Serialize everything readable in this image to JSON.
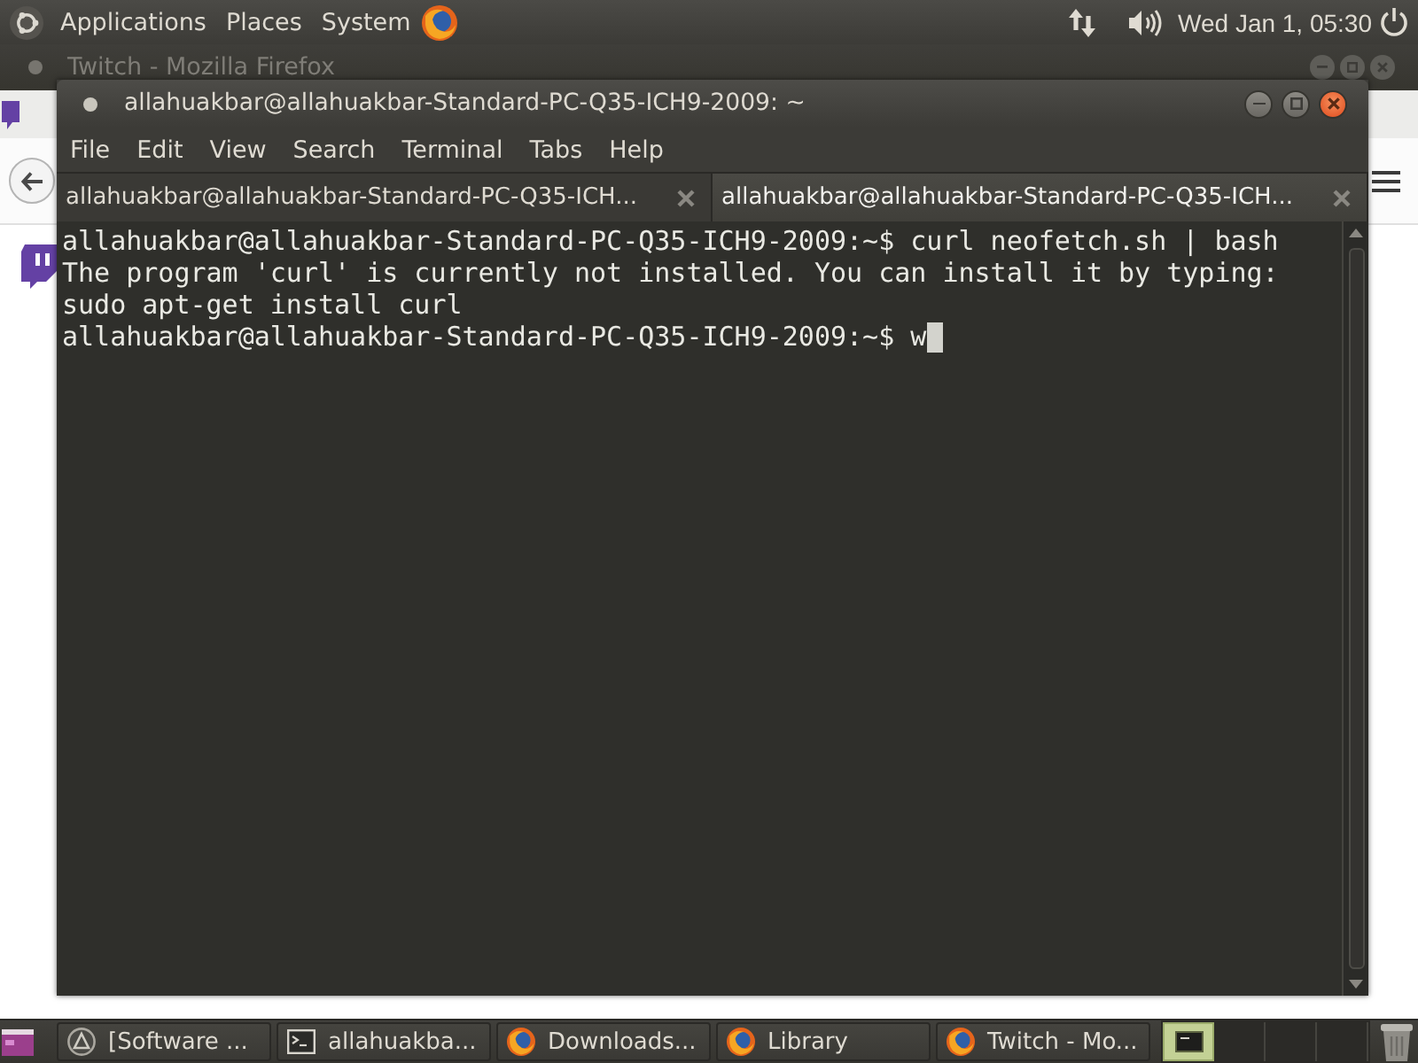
{
  "top_panel": {
    "menus": [
      "Applications",
      "Places",
      "System"
    ],
    "clock": "Wed Jan 1, 05:30"
  },
  "browser_window": {
    "title": "Twitch - Mozilla Firefox"
  },
  "terminal": {
    "title": "allahuakbar@allahuakbar-Standard-PC-Q35-ICH9-2009: ~",
    "menu": [
      "File",
      "Edit",
      "View",
      "Search",
      "Terminal",
      "Tabs",
      "Help"
    ],
    "tabs": [
      {
        "label": "allahuakbar@allahuakbar-Standard-PC-Q35-ICH...",
        "selected": false
      },
      {
        "label": "allahuakbar@allahuakbar-Standard-PC-Q35-ICH...",
        "selected": true
      }
    ],
    "lines": [
      "allahuakbar@allahuakbar-Standard-PC-Q35-ICH9-2009:~$ curl neofetch.sh | bash",
      "The program 'curl' is currently not installed. You can install it by typing:",
      "sudo apt-get install curl",
      "allahuakbar@allahuakbar-Standard-PC-Q35-ICH9-2009:~$ w"
    ]
  },
  "taskbar": {
    "items": [
      {
        "kind": "updater",
        "label": "[Software ..."
      },
      {
        "kind": "terminal",
        "label": "allahuakba..."
      },
      {
        "kind": "browser",
        "label": "Downloads..."
      },
      {
        "kind": "browser",
        "label": "Library"
      },
      {
        "kind": "browser",
        "label": "Twitch - Mo..."
      }
    ],
    "workspaces": [
      {
        "selected": true,
        "occupied": true
      },
      {
        "selected": false,
        "occupied": false
      },
      {
        "selected": false,
        "occupied": false
      },
      {
        "selected": false,
        "occupied": false
      }
    ]
  }
}
